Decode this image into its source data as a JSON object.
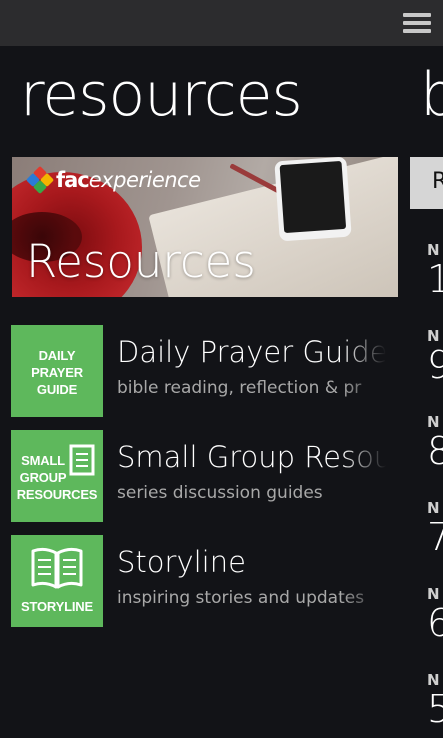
{
  "header": {
    "menu_icon": "hamburger-menu-icon"
  },
  "page": {
    "title": "resources",
    "next_title_peek": "b"
  },
  "banner": {
    "logo_fac": "fac",
    "logo_experience": "experience",
    "label": "Resources"
  },
  "items": [
    {
      "tile": [
        "DAILY",
        "PRAYER",
        "GUIDE"
      ],
      "title": "Daily Prayer Guide",
      "subtitle": "bible reading, reflection & pr"
    },
    {
      "tile": [
        "SMALL",
        "GROUP",
        "RESOURCES"
      ],
      "title": "Small Group Resou",
      "subtitle": "series discussion guides"
    },
    {
      "tile": [
        "STORYLINE"
      ],
      "title": "Storyline",
      "subtitle": "inspiring stories and updates"
    }
  ],
  "next_panel": {
    "button_label": "R",
    "dates": [
      {
        "month": "N",
        "day": "1"
      },
      {
        "month": "N",
        "day": "9"
      },
      {
        "month": "N",
        "day": "8"
      },
      {
        "month": "N",
        "day": "7"
      },
      {
        "month": "N",
        "day": "6"
      },
      {
        "month": "N",
        "day": "5"
      }
    ]
  },
  "colors": {
    "background": "#121317",
    "tile_green": "#5eb85c",
    "topbar": "#2c2c2e"
  }
}
